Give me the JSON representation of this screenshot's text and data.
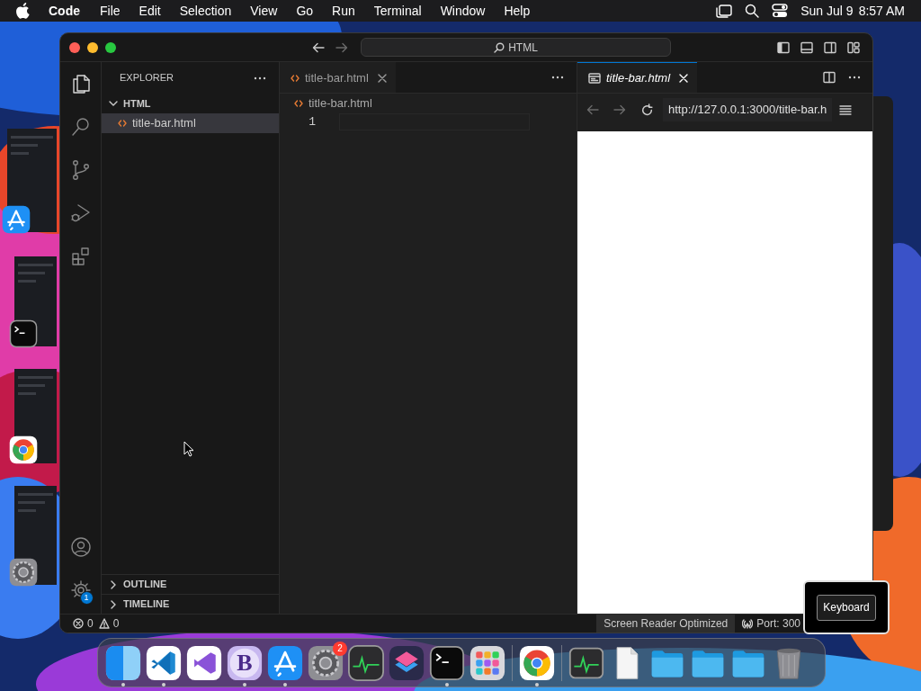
{
  "menu_bar": {
    "app": "Code",
    "menus": [
      "File",
      "Edit",
      "Selection",
      "View",
      "Go",
      "Run",
      "Terminal",
      "Window",
      "Help"
    ],
    "date": "Sun Jul 9",
    "time": "8:57 AM"
  },
  "stage_strip": [
    {
      "kind": "app-store"
    },
    {
      "kind": "terminal"
    },
    {
      "kind": "chrome"
    },
    {
      "kind": "settings"
    }
  ],
  "window": {
    "search": "HTML",
    "activity_bar": [
      {
        "kind": "files",
        "selected": true
      },
      {
        "kind": "search",
        "selected": false
      },
      {
        "kind": "branch",
        "selected": false
      },
      {
        "kind": "run",
        "selected": false
      },
      {
        "kind": "extensions",
        "selected": false
      }
    ],
    "settings_badge": "1",
    "explorer": {
      "title": "EXPLORER",
      "folder": {
        "label": "HTML",
        "expanded": true,
        "children": [
          {
            "label": "title-bar.html",
            "selected": true
          }
        ]
      },
      "sections": [
        {
          "label": "OUTLINE",
          "expanded": false
        },
        {
          "label": "TIMELINE",
          "expanded": false
        }
      ]
    },
    "editor_groups": [
      {
        "tab": {
          "label": "title-bar.html",
          "kind": "file",
          "focused": false
        },
        "breadcrumb": "title-bar.html",
        "lines": [
          "1"
        ]
      },
      {
        "tab": {
          "label": "title-bar.html",
          "kind": "preview",
          "focused": true
        },
        "url": "http://127.0.0.1:3000/title-bar.h"
      }
    ],
    "status_bar": {
      "errors": "0",
      "warnings": "0",
      "items": [
        {
          "label": "Screen Reader Optimized",
          "kind": "plain"
        },
        {
          "label": "Port: 300",
          "kind": "port"
        }
      ]
    }
  },
  "keyboard_overlay": {
    "label": "Keyboard"
  },
  "dock": [
    {
      "kind": "finder",
      "running": true
    },
    {
      "kind": "vscode",
      "running": true
    },
    {
      "kind": "vs",
      "running": false
    },
    {
      "kind": "letter",
      "label": "B",
      "running": true
    },
    {
      "kind": "app-store",
      "running": true
    },
    {
      "kind": "settings",
      "running": false,
      "badge": "2"
    },
    {
      "kind": "monitor",
      "running": false
    },
    {
      "kind": "shortcuts",
      "running": false
    },
    {
      "kind": "terminal",
      "running": true
    },
    {
      "kind": "launchpad",
      "running": false
    },
    {
      "kind": "separator"
    },
    {
      "kind": "chrome",
      "running": true
    },
    {
      "kind": "separator"
    },
    {
      "kind": "monitor-window",
      "running": false
    },
    {
      "kind": "document",
      "running": false
    },
    {
      "kind": "folder",
      "running": false
    },
    {
      "kind": "folder",
      "running": false
    },
    {
      "kind": "folder",
      "running": false
    },
    {
      "kind": "trash",
      "running": false
    }
  ]
}
